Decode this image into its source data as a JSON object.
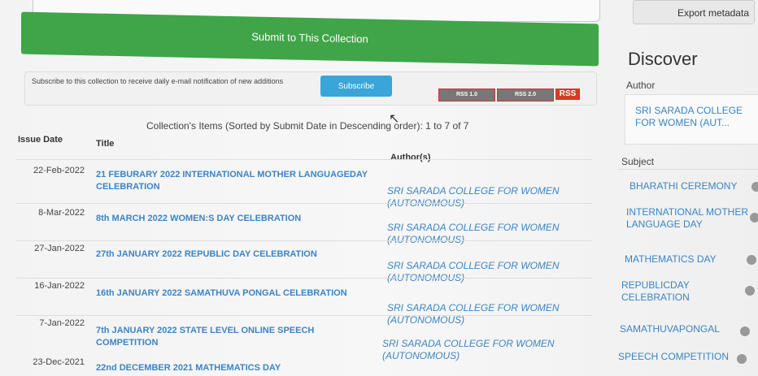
{
  "export": {
    "label": "Export metadata"
  },
  "submit": {
    "label": "Submit to This Collection"
  },
  "subscribe": {
    "text": "Subscribe to this collection to receive daily e-mail notification of new additions",
    "button": "Subscribe",
    "rss1": "RSS 1.0",
    "rss2": "RSS 2.0",
    "rss3": "RSS"
  },
  "items": {
    "caption": "Collection's Items (Sorted by Submit Date in Descending order): 1 to 7 of 7",
    "headers": {
      "date": "Issue Date",
      "title": "Title",
      "author": "Author(s)"
    },
    "rows": [
      {
        "date": "22-Feb-2022",
        "title": "21 FEBURARY 2022 INTERNATIONAL MOTHER LANGUAGEDAY CELEBRATION",
        "author": "SRI SARADA COLLEGE FOR WOMEN (AUTONOMOUS)"
      },
      {
        "date": "8-Mar-2022",
        "title": "8th MARCH 2022 WOMEN:S DAY CELEBRATION",
        "author": "SRI SARADA COLLEGE FOR WOMEN (AUTONOMOUS)"
      },
      {
        "date": "27-Jan-2022",
        "title": "27th JANUARY 2022 REPUBLIC DAY CELEBRATION",
        "author": "SRI SARADA COLLEGE FOR WOMEN (AUTONOMOUS)"
      },
      {
        "date": "16-Jan-2022",
        "title": "16th JANUARY 2022 SAMATHUVA PONGAL CELEBRATION",
        "author": "SRI SARADA COLLEGE FOR WOMEN (AUTONOMOUS)"
      },
      {
        "date": "7-Jan-2022",
        "title": "7th JANUARY 2022 STATE LEVEL ONLINE SPEECH COMPETITION",
        "author": "SRI SARADA COLLEGE FOR WOMEN (AUTONOMOUS)"
      },
      {
        "date": "23-Dec-2021",
        "title": "22nd DECEMBER 2021 MATHEMATICS DAY",
        "author": ""
      }
    ]
  },
  "sidebar": {
    "title": "Discover",
    "author_label": "Author",
    "author_value": "SRI SARADA COLLEGE FOR WOMEN (AUT...",
    "subject_label": "Subject",
    "subjects": [
      {
        "label": "BHARATHI CEREMONY"
      },
      {
        "label": "INTERNATIONAL MOTHER LANGUAGE DAY"
      },
      {
        "label": "MATHEMATICS DAY"
      },
      {
        "label": "REPUBLICDAY CELEBRATION"
      },
      {
        "label": "SAMATHUVAPONGAL"
      },
      {
        "label": "SPEECH COMPETITION"
      }
    ]
  }
}
